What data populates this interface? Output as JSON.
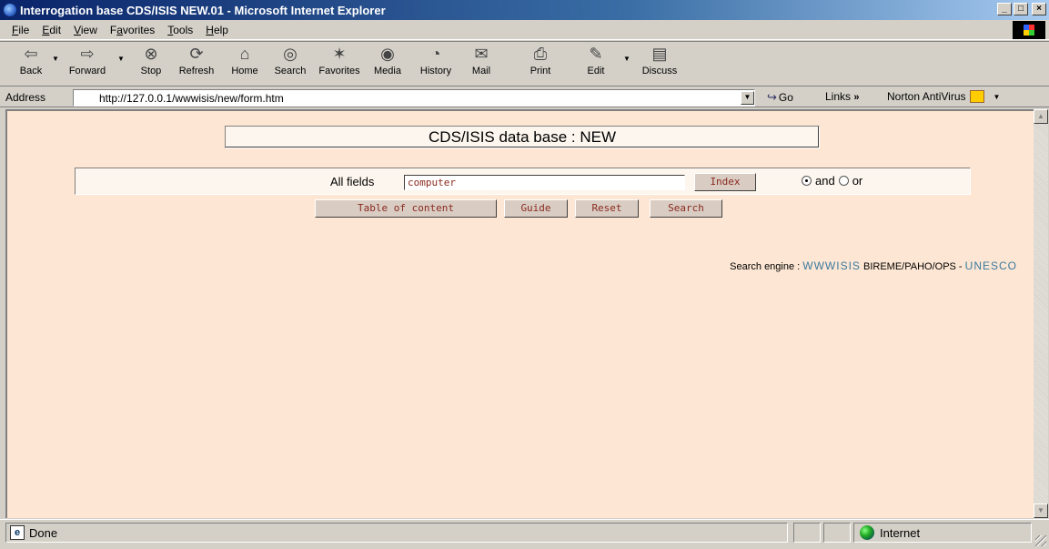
{
  "window": {
    "title": "Interrogation base CDS/ISIS NEW.01 - Microsoft Internet Explorer",
    "controls": {
      "minimize": "_",
      "maximize": "□",
      "close": "×"
    }
  },
  "menu": {
    "items": [
      {
        "underline": "F",
        "rest": "ile"
      },
      {
        "underline": "E",
        "rest": "dit"
      },
      {
        "underline": "V",
        "rest": "iew"
      },
      {
        "pre": "F",
        "underline": "a",
        "rest": "vorites"
      },
      {
        "underline": "T",
        "rest": "ools"
      },
      {
        "underline": "H",
        "rest": "elp"
      }
    ]
  },
  "toolbar": {
    "back": "Back",
    "forward": "Forward",
    "stop": "Stop",
    "refresh": "Refresh",
    "home": "Home",
    "search": "Search",
    "favorites": "Favorites",
    "media": "Media",
    "history": "History",
    "mail": "Mail",
    "print": "Print",
    "edit": "Edit",
    "discuss": "Discuss",
    "icons": {
      "back": "back-arrow-icon",
      "forward": "forward-arrow-icon",
      "stop": "stop-icon",
      "refresh": "refresh-icon",
      "home": "home-icon",
      "search": "search-globe-icon",
      "favorites": "favorites-star-icon",
      "media": "media-icon",
      "history": "history-icon",
      "mail": "mail-icon",
      "print": "printer-icon",
      "edit": "edit-icon",
      "discuss": "discuss-icon"
    }
  },
  "address": {
    "label": "Address",
    "url": "http://127.0.0.1/wwwisis/new/form.htm",
    "go": "Go",
    "links": "Links",
    "links_chevron": "»",
    "norton": "Norton AntiVirus"
  },
  "page": {
    "db_title": "CDS/ISIS data base : NEW",
    "field_label": "All fields",
    "query": "computer",
    "index_button": "Index",
    "operator_and": "and",
    "operator_or": "or",
    "selected_operator": "and",
    "buttons": {
      "toc": "Table of content",
      "guide": "Guide",
      "reset": "Reset",
      "search": "Search"
    },
    "engine_prefix": "Search engine :",
    "engine_link": "WWWISIS",
    "engine_org": "BIREME/PAHO/OPS -",
    "unesco_link": "UNESCO",
    "background_color": "#fde6d3",
    "link_color": "#3a7aa0",
    "button_text_color": "#8b2a1f"
  },
  "status": {
    "text": "Done",
    "zone": "Internet"
  }
}
